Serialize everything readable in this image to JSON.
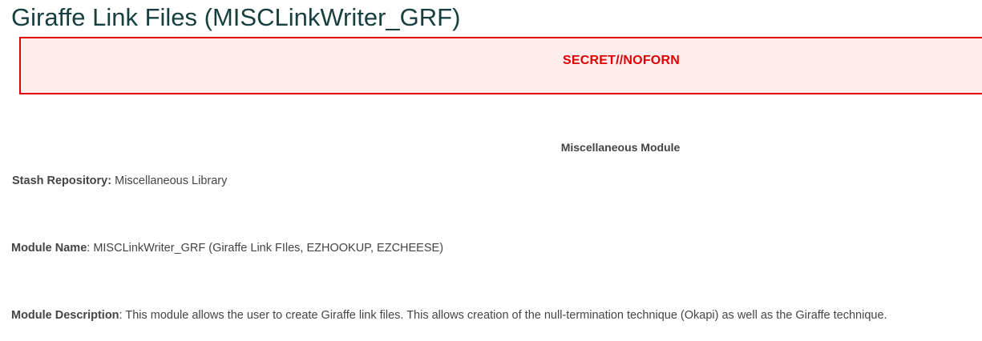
{
  "page": {
    "title": "Giraffe Link Files (MISCLinkWriter_GRF)"
  },
  "banner": {
    "classification": "SECRET//NOFORN"
  },
  "content": {
    "section_heading": "Miscellaneous Module",
    "fields": [
      {
        "label": "Stash Repository:",
        "value": " Miscellaneous Library"
      },
      {
        "label": "Module Name",
        "value": ": MISCLinkWriter_GRF (Giraffe Link FIles, EZHOOKUP, EZCHEESE)"
      },
      {
        "label": "Module Description",
        "value": ": This module allows the user to create Giraffe link files. This allows creation of the null-termination technique (Okapi) as well as the Giraffe technique."
      }
    ]
  },
  "colors": {
    "title": "#173f3f",
    "banner_border": "#e00000",
    "banner_background": "#ffecec",
    "banner_text": "#e00000",
    "body_text": "#444444"
  }
}
